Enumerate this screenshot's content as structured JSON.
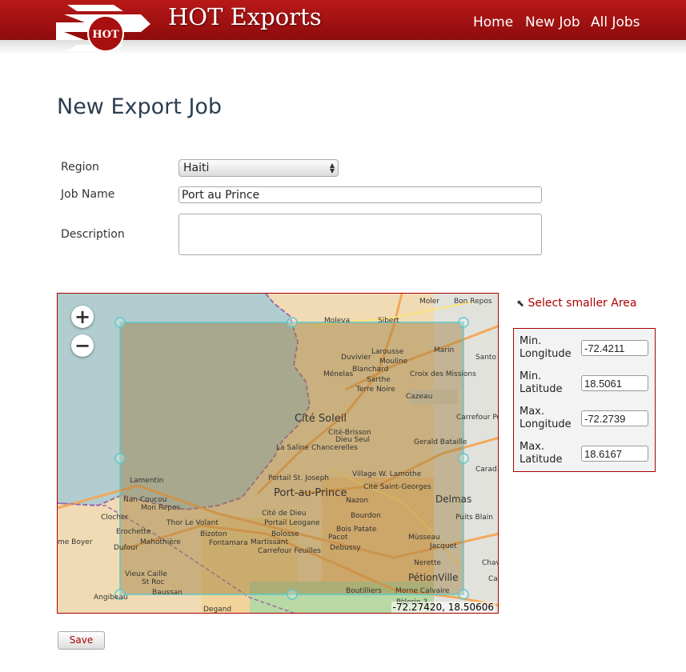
{
  "header": {
    "logo_text": "HOT",
    "app_title": "HOT Exports",
    "nav": [
      "Home",
      "New Job",
      "All Jobs"
    ]
  },
  "page_title": "New Export Job",
  "form": {
    "region_label": "Region",
    "region_value": "Haiti",
    "job_name_label": "Job Name",
    "job_name_value": "Port au Prince",
    "description_label": "Description",
    "description_value": ""
  },
  "map": {
    "zoom_in": "+",
    "zoom_out": "−",
    "mouse_position": "-72.27420, 18.50606",
    "places": [
      "Moler",
      "Bon Repos",
      "Moleva",
      "Sibert",
      "Marin",
      "Santo",
      "Duvivier",
      "Larousse",
      "Mouline",
      "Blanchard",
      "Ménelas",
      "Sarthe",
      "Croix des Missions",
      "Terre Noire",
      "Cazeau",
      "Cité Soleil",
      "Carrefour Po",
      "Cité-Brisson",
      "Dieu Seul",
      "La Saline",
      "Chancerelles",
      "Gerald Bataille",
      "Carad",
      "Village W. Lamothe",
      "Portail St. Joseph",
      "Cité Saint-Georges",
      "Lamentin",
      "Port-au-Prince",
      "Delmas",
      "Nazon",
      "Nan Coucou",
      "Mon Repos",
      "Cité de Dieu",
      "Clocher",
      "Bourdon",
      "Puits Blain",
      "Thor Le Volant",
      "Portail Leogane",
      "Erochette",
      "Bois Patate",
      "Bizoton",
      "Bolosse",
      "Pacot",
      "me Boyer",
      "Mahothière",
      "Fontamara",
      "Martissant",
      "Mùsseau",
      "Dufour",
      "Debussy",
      "Carrefour Feuilles",
      "Jacquet",
      "Nerette",
      "Chav",
      "Vieux Caille",
      "St Roc",
      "PétionVille",
      "Ca",
      "Baussan",
      "Boutilliers",
      "Morne Calvaire",
      "Angibeau",
      "Pèlerin 3",
      "Degand"
    ]
  },
  "area_link": "Select smaller Area",
  "bbox": [
    {
      "label": [
        "Min.",
        "Longitude"
      ],
      "value": "-72.4211"
    },
    {
      "label": [
        "Min.",
        "Latitude"
      ],
      "value": "18.5061"
    },
    {
      "label": [
        "Max.",
        "Longitude"
      ],
      "value": "-72.2739"
    },
    {
      "label": [
        "Max.",
        "Latitude"
      ],
      "value": "18.6167"
    }
  ],
  "save_label": "Save",
  "colors": {
    "brand": "#a80f0f",
    "selection_stroke": "#5fc8c8",
    "water": "#b1cdcf"
  }
}
